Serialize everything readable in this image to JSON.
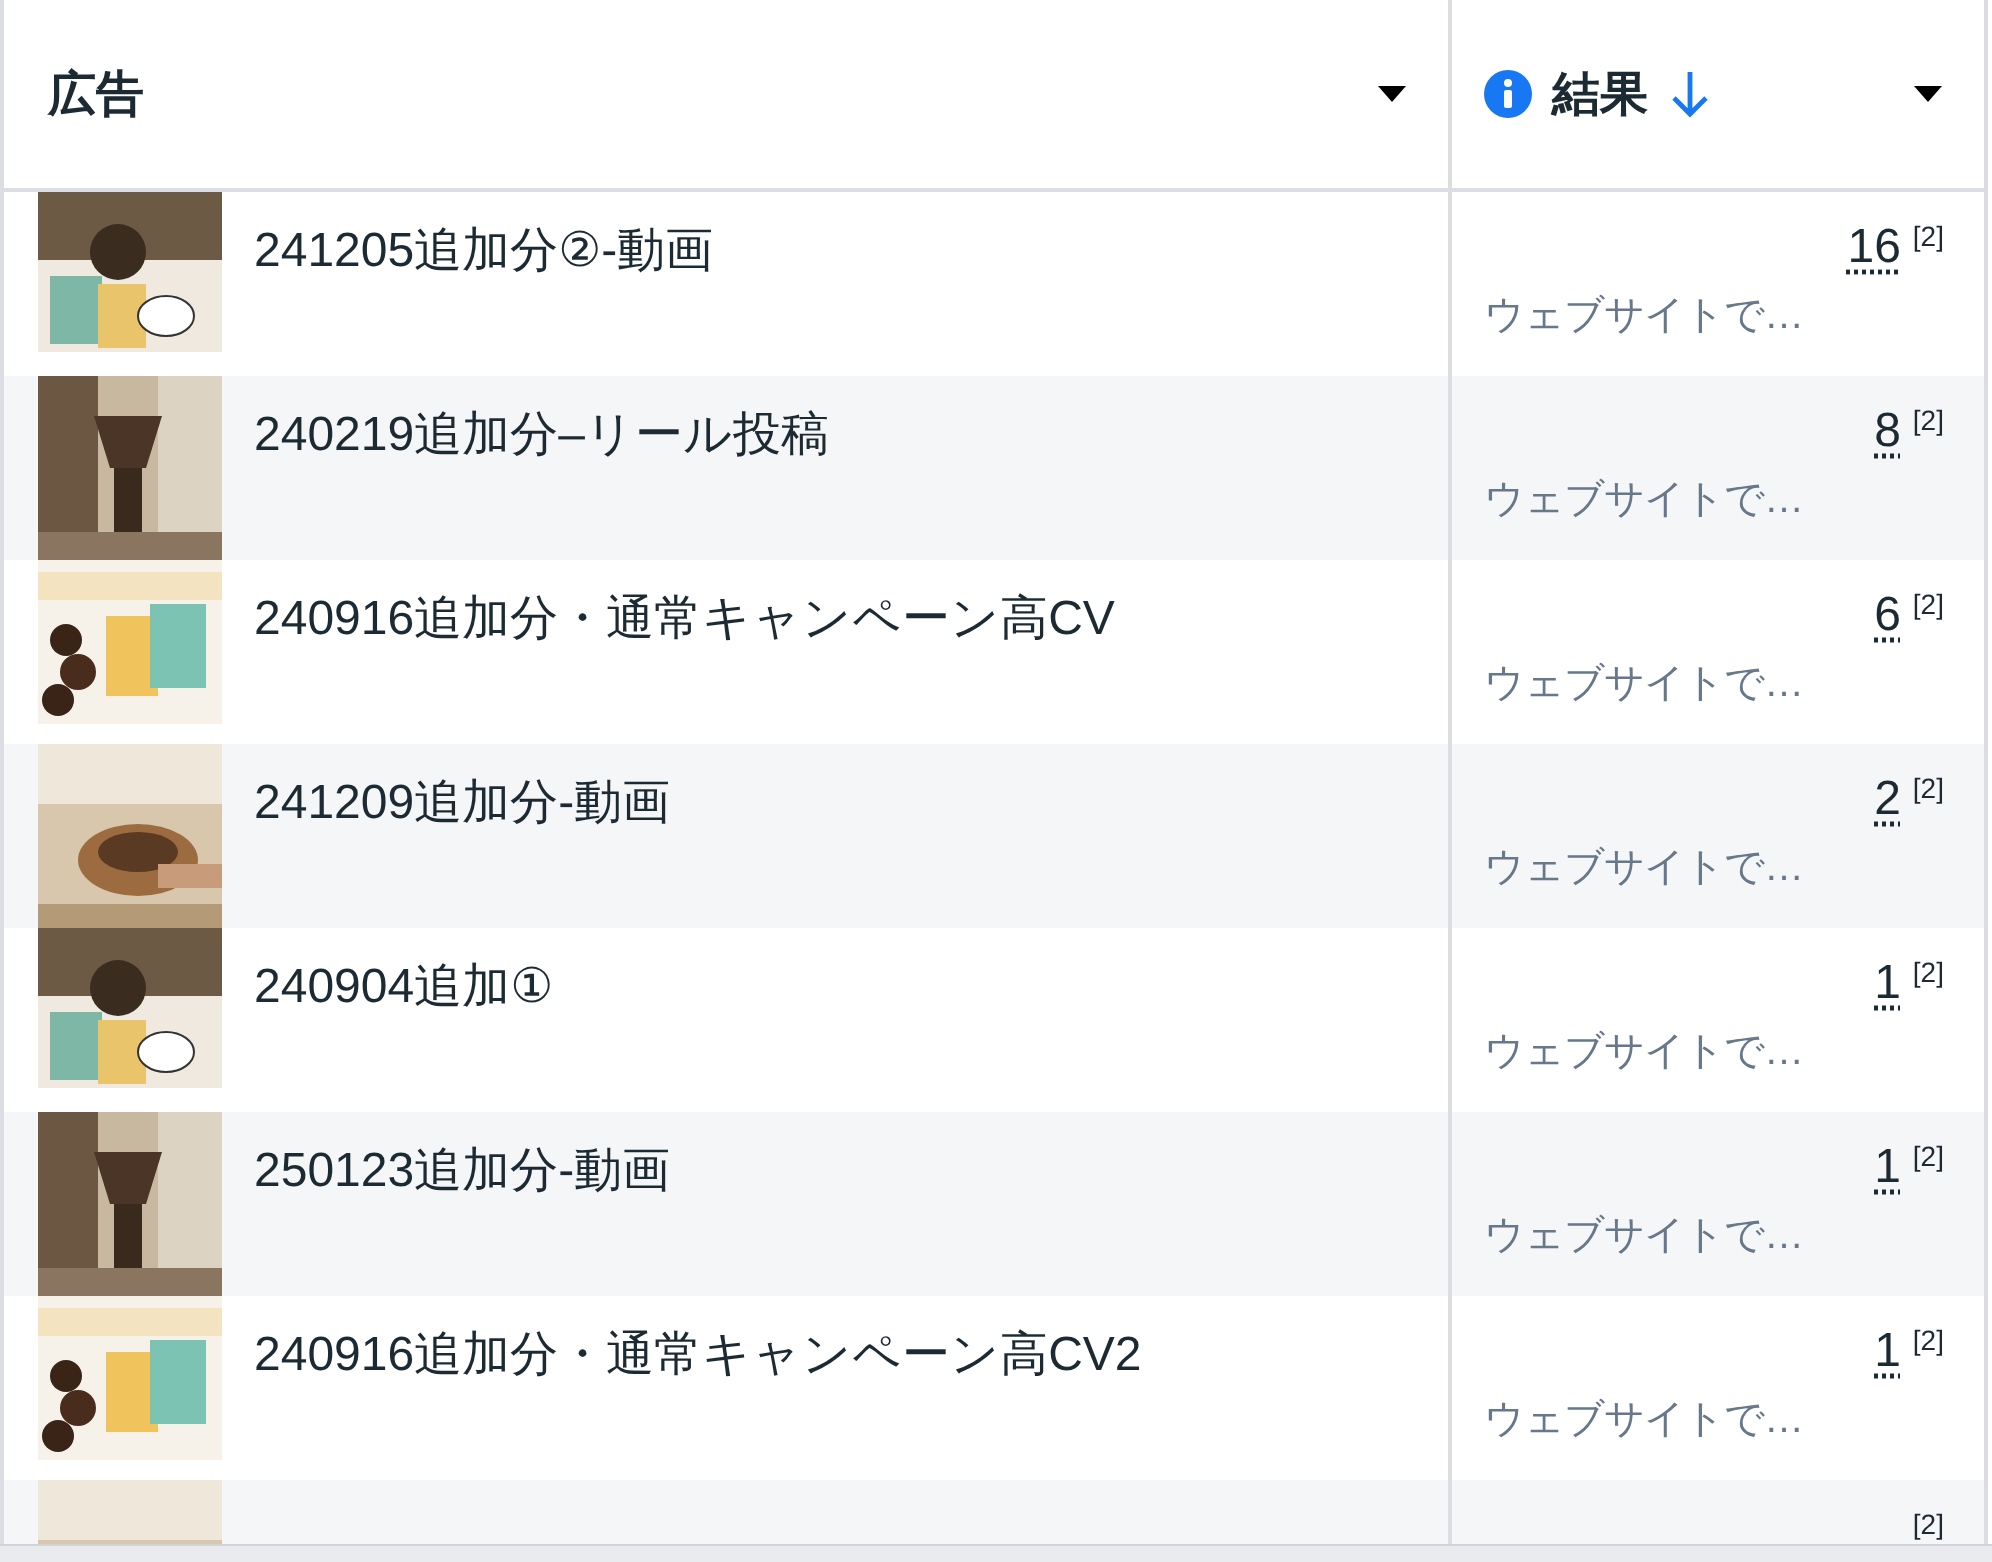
{
  "table": {
    "columns": [
      {
        "label": "広告"
      },
      {
        "label": "結果"
      }
    ],
    "rows": [
      {
        "name": "241205追加分②-動画",
        "result": "16",
        "footnote": "[2]",
        "result_type": "ウェブサイトで…"
      },
      {
        "name": "240219追加分–リール投稿",
        "result": "8",
        "footnote": "[2]",
        "result_type": "ウェブサイトで…"
      },
      {
        "name": "240916追加分・通常キャンペーン高CV",
        "result": "6",
        "footnote": "[2]",
        "result_type": "ウェブサイトで…"
      },
      {
        "name": "241209追加分-動画",
        "result": "2",
        "footnote": "[2]",
        "result_type": "ウェブサイトで…"
      },
      {
        "name": "240904追加①",
        "result": "1",
        "footnote": "[2]",
        "result_type": "ウェブサイトで…"
      },
      {
        "name": "250123追加分-動画",
        "result": "1",
        "footnote": "[2]",
        "result_type": "ウェブサイトで…"
      },
      {
        "name": "240916追加分・通常キャンペーン高CV2",
        "result": "1",
        "footnote": "[2]",
        "result_type": "ウェブサイトで…"
      },
      {
        "footnote": "[2]"
      }
    ]
  }
}
